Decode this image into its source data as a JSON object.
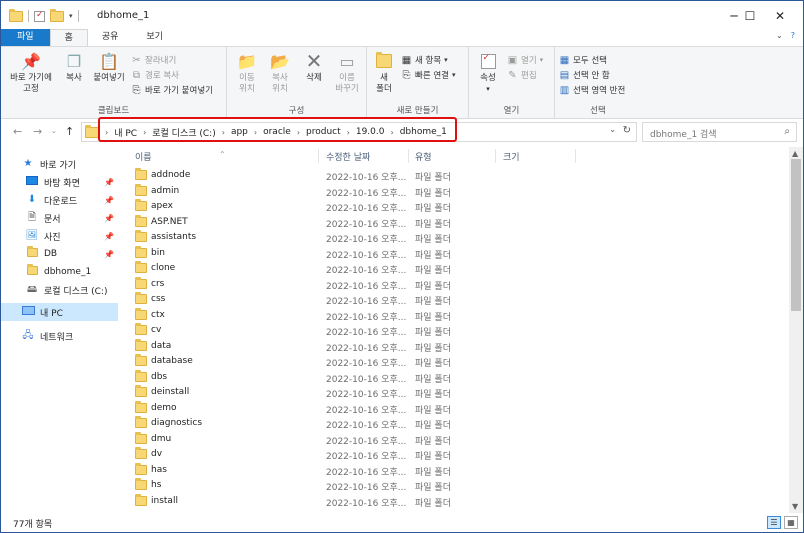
{
  "window": {
    "title": "dbhome_1",
    "controls": {
      "minimize": "─",
      "maximize": "☐",
      "close": "✕"
    }
  },
  "ribbon_tabs": [
    {
      "label": "파일"
    },
    {
      "label": "홈"
    },
    {
      "label": "공유"
    },
    {
      "label": "보기"
    }
  ],
  "ribbon": {
    "clipboard": {
      "pin_label": "바로 가기에\n고정",
      "copy_label": "복사",
      "paste_label": "붙여넣기",
      "cut_label": "잘라내기",
      "copy_path_label": "경로 복사",
      "paste_shortcut_label": "바로 가기 붙여넣기",
      "group_label": "클립보드"
    },
    "organize": {
      "move_label": "이동\n위치",
      "copy_to_label": "복사\n위치",
      "delete_label": "삭제",
      "rename_label": "이름\n바꾸기",
      "group_label": "구성"
    },
    "new": {
      "new_folder_label": "새\n폴더",
      "new_item_label": "새 항목",
      "easy_access_label": "빠른 연결",
      "group_label": "새로 만들기"
    },
    "open": {
      "properties_label": "속성",
      "open_label": "열기",
      "edit_label": "편집",
      "group_label": "열기"
    },
    "select": {
      "select_all_label": "모두 선택",
      "select_none_label": "선택 안 함",
      "invert_label": "선택 영역 반전",
      "group_label": "선택"
    }
  },
  "address": {
    "crumbs": [
      "내 PC",
      "로컬 디스크 (C:)",
      "app",
      "oracle",
      "product",
      "19.0.0",
      "dbhome_1"
    ],
    "search_placeholder": "dbhome_1 검색"
  },
  "nav_pane": {
    "items": [
      {
        "label": "바로 가기",
        "icon": "star-icon"
      },
      {
        "label": "바탕 화면",
        "icon": "desktop-icon",
        "pinned": true
      },
      {
        "label": "다운로드",
        "icon": "download-icon",
        "pinned": true
      },
      {
        "label": "문서",
        "icon": "document-icon",
        "pinned": true
      },
      {
        "label": "사진",
        "icon": "picture-icon",
        "pinned": true
      },
      {
        "label": "DB",
        "icon": "folder-icon",
        "pinned": true
      },
      {
        "label": "dbhome_1",
        "icon": "folder-icon"
      },
      {
        "label": "로컬 디스크 (C:)",
        "icon": "drive-icon"
      },
      {
        "label": "내 PC",
        "icon": "pc-icon",
        "selected": true
      },
      {
        "label": "네트워크",
        "icon": "network-icon"
      }
    ]
  },
  "columns": {
    "name": "이름",
    "date": "수정한 날짜",
    "type": "유형",
    "size": "크기"
  },
  "files": [
    {
      "name": "addnode",
      "date": "2022-10-16 오후...",
      "type": "파일 폴더"
    },
    {
      "name": "admin",
      "date": "2022-10-16 오후...",
      "type": "파일 폴더"
    },
    {
      "name": "apex",
      "date": "2022-10-16 오후...",
      "type": "파일 폴더"
    },
    {
      "name": "ASP.NET",
      "date": "2022-10-16 오후...",
      "type": "파일 폴더"
    },
    {
      "name": "assistants",
      "date": "2022-10-16 오후...",
      "type": "파일 폴더"
    },
    {
      "name": "bin",
      "date": "2022-10-16 오후...",
      "type": "파일 폴더"
    },
    {
      "name": "clone",
      "date": "2022-10-16 오후...",
      "type": "파일 폴더"
    },
    {
      "name": "crs",
      "date": "2022-10-16 오후...",
      "type": "파일 폴더"
    },
    {
      "name": "css",
      "date": "2022-10-16 오후...",
      "type": "파일 폴더"
    },
    {
      "name": "ctx",
      "date": "2022-10-16 오후...",
      "type": "파일 폴더"
    },
    {
      "name": "cv",
      "date": "2022-10-16 오후...",
      "type": "파일 폴더"
    },
    {
      "name": "data",
      "date": "2022-10-16 오후...",
      "type": "파일 폴더"
    },
    {
      "name": "database",
      "date": "2022-10-16 오후...",
      "type": "파일 폴더"
    },
    {
      "name": "dbs",
      "date": "2022-10-16 오후...",
      "type": "파일 폴더"
    },
    {
      "name": "deinstall",
      "date": "2022-10-16 오후...",
      "type": "파일 폴더"
    },
    {
      "name": "demo",
      "date": "2022-10-16 오후...",
      "type": "파일 폴더"
    },
    {
      "name": "diagnostics",
      "date": "2022-10-16 오후...",
      "type": "파일 폴더"
    },
    {
      "name": "dmu",
      "date": "2022-10-16 오후...",
      "type": "파일 폴더"
    },
    {
      "name": "dv",
      "date": "2022-10-16 오후...",
      "type": "파일 폴더"
    },
    {
      "name": "has",
      "date": "2022-10-16 오후...",
      "type": "파일 폴더"
    },
    {
      "name": "hs",
      "date": "2022-10-16 오후...",
      "type": "파일 폴더"
    },
    {
      "name": "install",
      "date": "2022-10-16 오후...",
      "type": "파일 폴더"
    }
  ],
  "status": {
    "item_count": "77개 항목"
  }
}
